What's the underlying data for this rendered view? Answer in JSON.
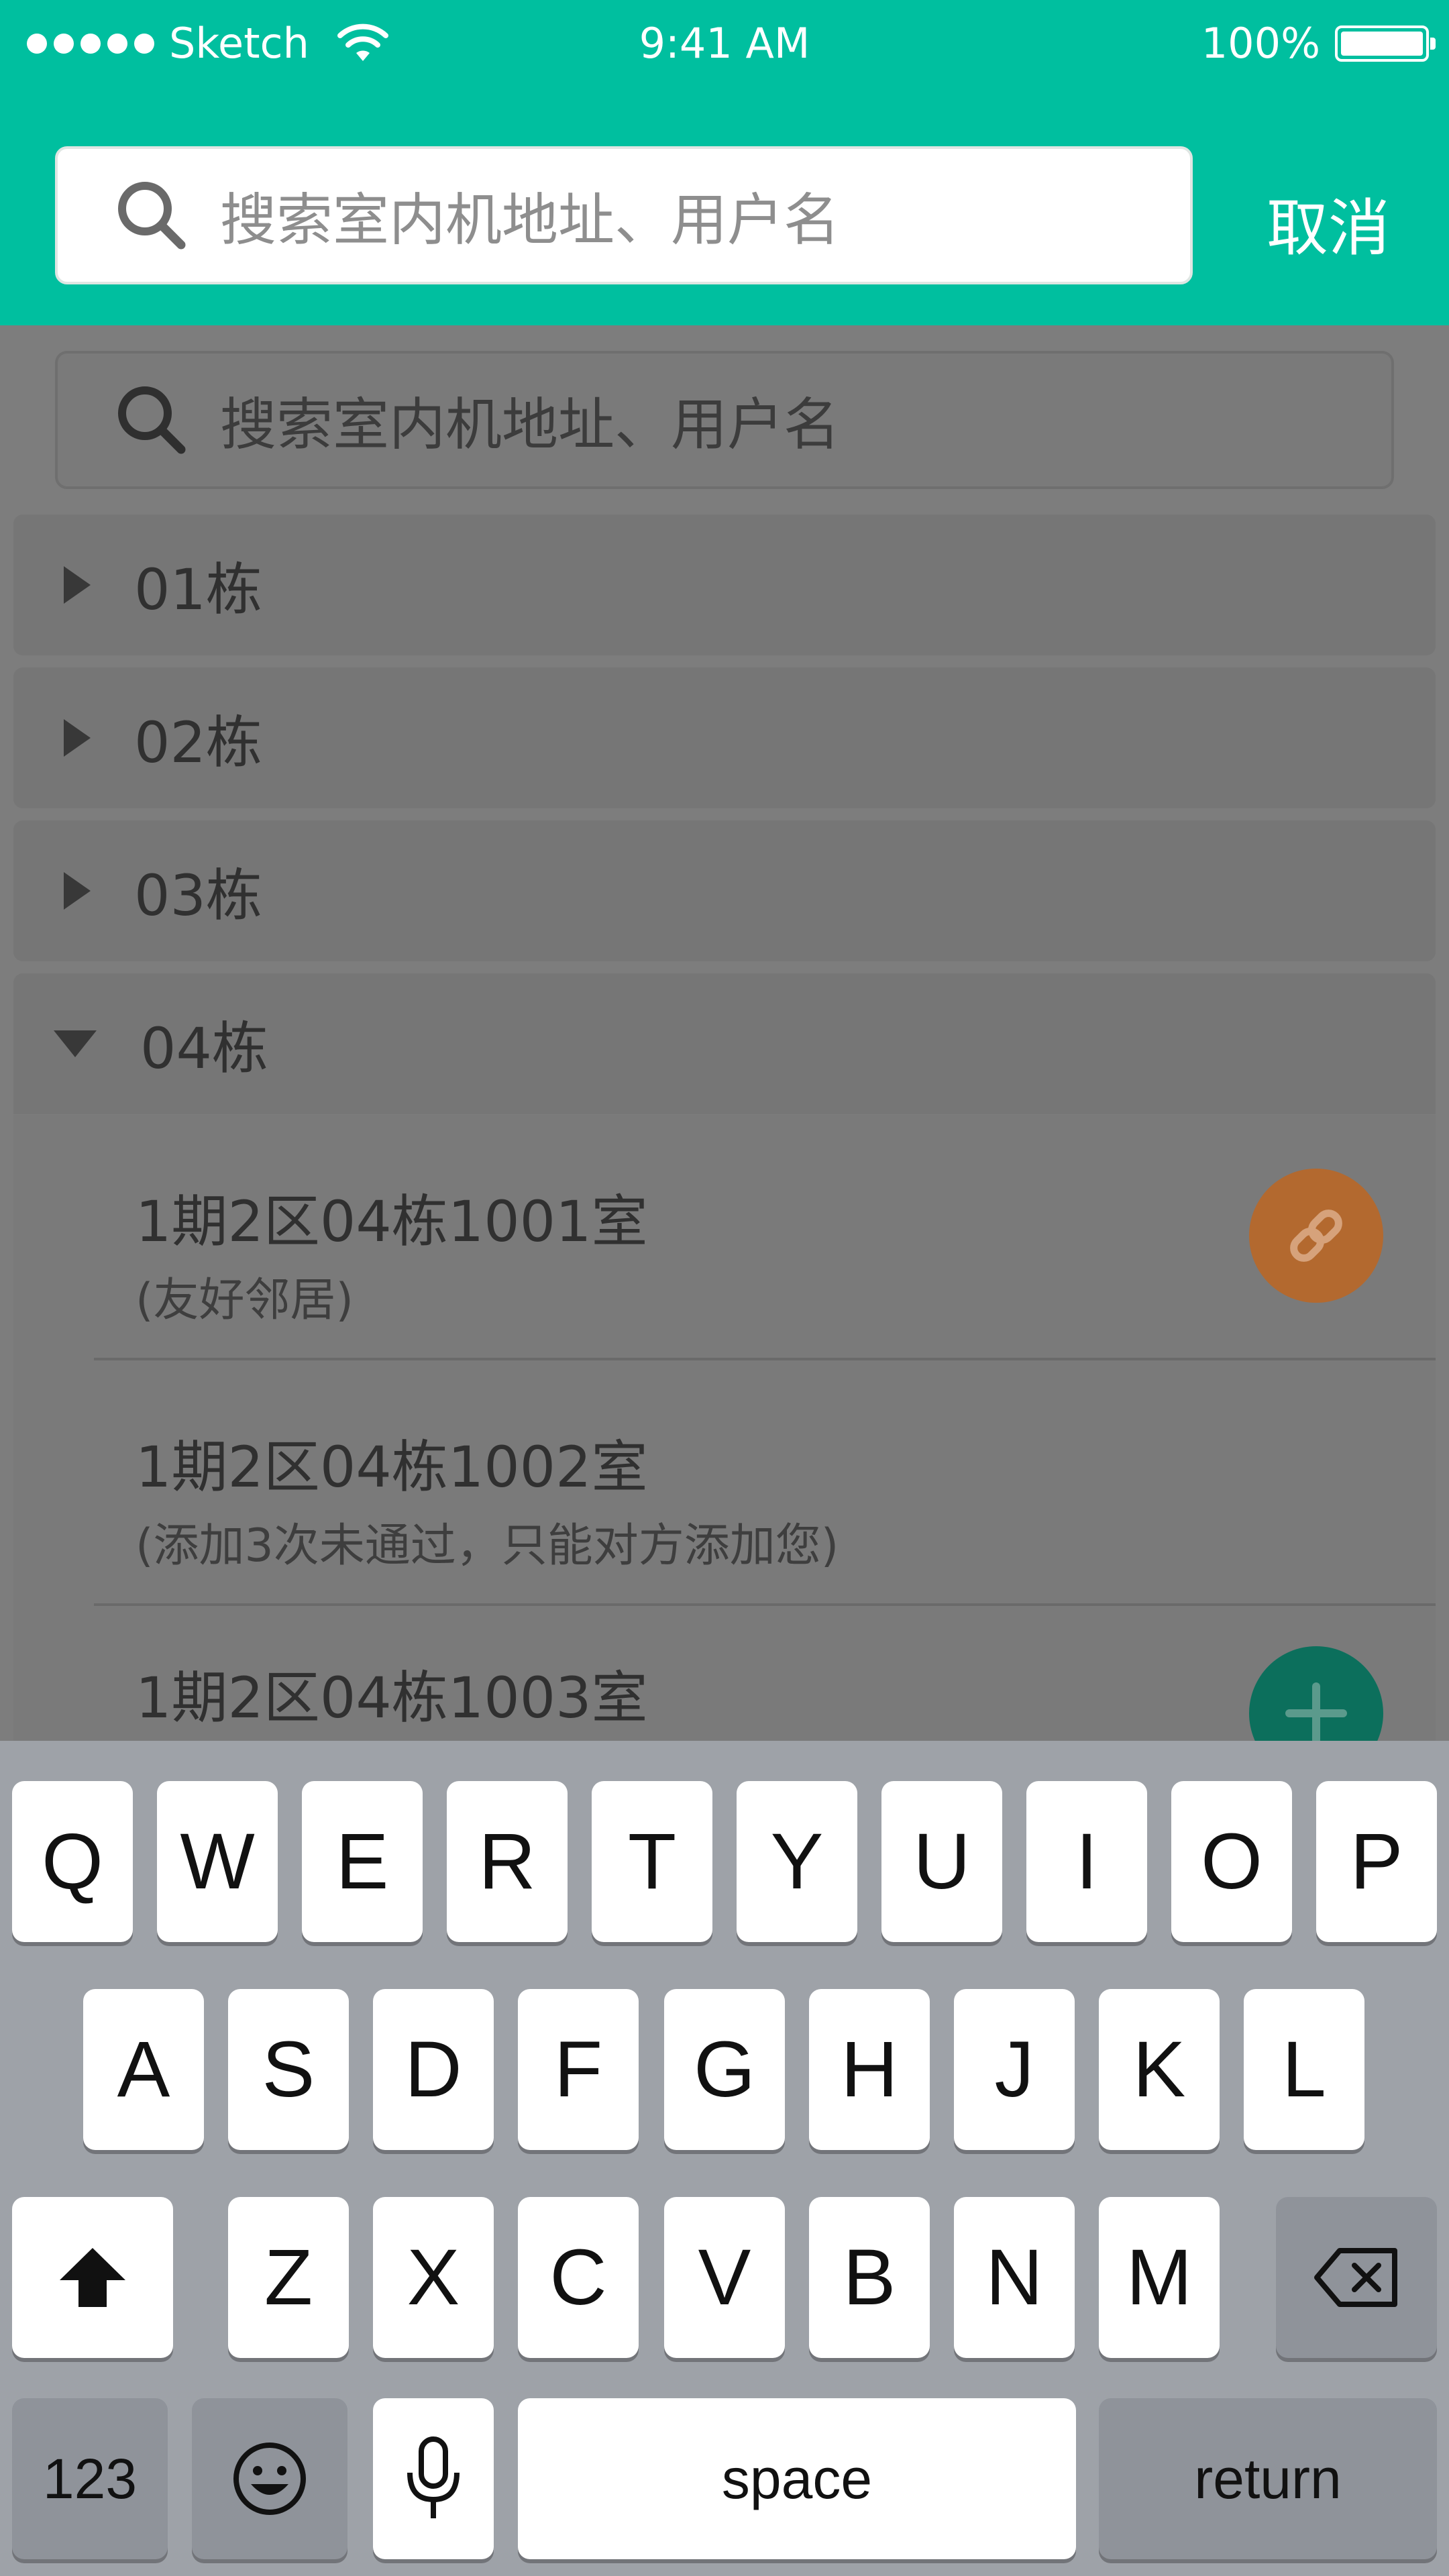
{
  "status_bar": {
    "carrier": "Sketch",
    "time": "9:41 AM",
    "battery": "100%"
  },
  "header": {
    "search_placeholder": "搜索室内机地址、用户名",
    "cancel_label": "取消"
  },
  "background": {
    "search_placeholder": "搜索室内机地址、用户名",
    "buildings": [
      {
        "label": "01栋",
        "expanded": false
      },
      {
        "label": "02栋",
        "expanded": false
      },
      {
        "label": "03栋",
        "expanded": false
      },
      {
        "label": "04栋",
        "expanded": true
      }
    ],
    "rooms": [
      {
        "title": "1期2区04栋1001室",
        "subtitle": "(友好邻居)",
        "action_icon": "link-icon"
      },
      {
        "title": "1期2区04栋1002室",
        "subtitle": "(添加3次未通过，只能对方添加您)",
        "action_icon": ""
      },
      {
        "title": "1期2区04栋1003室",
        "subtitle": "",
        "action_icon": "plus-icon"
      }
    ]
  },
  "keyboard": {
    "row1": [
      "Q",
      "W",
      "E",
      "R",
      "T",
      "Y",
      "U",
      "I",
      "O",
      "P"
    ],
    "row2": [
      "A",
      "S",
      "D",
      "F",
      "G",
      "H",
      "J",
      "K",
      "L"
    ],
    "row3": [
      "Z",
      "X",
      "C",
      "V",
      "B",
      "N",
      "M"
    ],
    "numbers_label": "123",
    "space_label": "space",
    "return_label": "return"
  },
  "colors": {
    "accent": "#00bf9f",
    "link_button": "#b3692f",
    "add_button": "#0c6f5c"
  }
}
